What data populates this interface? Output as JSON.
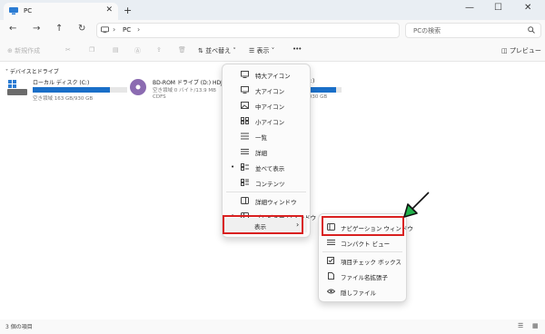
{
  "tab": {
    "label": "PC",
    "close": "✕",
    "new": "+"
  },
  "window_buttons": {
    "minimize": "—",
    "maximize": "☐",
    "close": "✕"
  },
  "address": {
    "path": "PC",
    "separator": "›",
    "search_placeholder": "PCの検索"
  },
  "toolbar": {
    "new": "新規作成",
    "sort": "並べ替え",
    "view": "表示",
    "more": "•••",
    "preview": "プレビュー"
  },
  "section": {
    "label": "デバイスとドライブ"
  },
  "drives": [
    {
      "name": "ローカル ディスク (C:)",
      "sub": "空き領域 163 GB/930 GB",
      "used_fraction": 0.82
    },
    {
      "name": "BD-ROM ドライブ (D:) HDJASU",
      "sub1": "空き領域 0 バイト/13.9 MB",
      "sub2": "CDFS"
    },
    {
      "name_tail": "K:)",
      "sub": "/930 GB",
      "used_fraction": 0.85
    }
  ],
  "view_menu": {
    "items": [
      {
        "label": "特大アイコン",
        "icon": "monitor-icon"
      },
      {
        "label": "大アイコン",
        "icon": "monitor-icon"
      },
      {
        "label": "中アイコン",
        "icon": "image-icon"
      },
      {
        "label": "小アイコン",
        "icon": "grid-icon"
      },
      {
        "label": "一覧",
        "icon": "list-icon"
      },
      {
        "label": "詳細",
        "icon": "details-icon"
      },
      {
        "label": "並べて表示",
        "icon": "tiles-icon",
        "selected": true
      },
      {
        "label": "コンテンツ",
        "icon": "content-icon"
      },
      {
        "label": "詳細ウィンドウ",
        "icon": "details-pane-icon"
      },
      {
        "label": "プレビュー ウィンドウ",
        "icon": "preview-pane-icon",
        "selected": true
      },
      {
        "label": "表示",
        "submenu": true
      }
    ],
    "bullet": "•",
    "chevron": "›"
  },
  "show_submenu": {
    "items": [
      {
        "label": "ナビゲーション ウィンドウ",
        "icon": "nav-pane-icon"
      },
      {
        "label": "コンパクト ビュー",
        "icon": "compact-icon"
      },
      {
        "label": "項目チェック ボックス",
        "icon": "checkbox-icon"
      },
      {
        "label": "ファイル名拡張子",
        "icon": "file-icon"
      },
      {
        "label": "隠しファイル",
        "icon": "eye-icon"
      }
    ]
  },
  "status": {
    "count": "3 個の項目"
  },
  "colors": {
    "accent": "#1a6fc8",
    "highlight": "#d92020",
    "arrow": "#22b14c"
  }
}
